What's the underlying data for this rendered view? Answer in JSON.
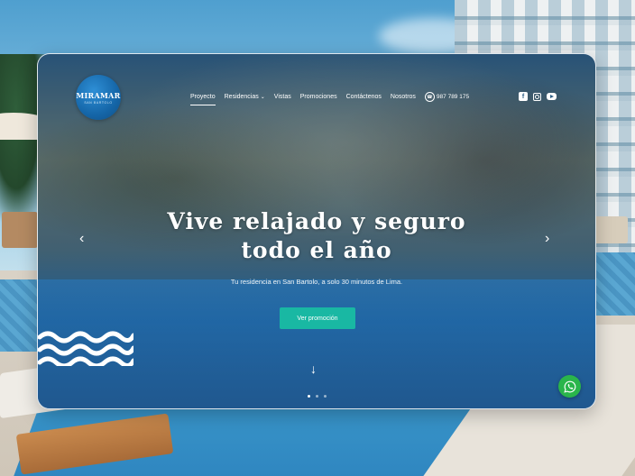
{
  "brand": {
    "name": "MIRAMAR",
    "tagline": "SAN BARTOLO"
  },
  "nav": {
    "items": [
      {
        "label": "Proyecto",
        "active": true
      },
      {
        "label": "Residencias",
        "has_caret": true
      },
      {
        "label": "Vistas"
      },
      {
        "label": "Promociones"
      },
      {
        "label": "Contáctenos"
      },
      {
        "label": "Nosotros"
      }
    ],
    "phone": "987 789 175",
    "socials": [
      "facebook-icon",
      "instagram-icon",
      "youtube-icon"
    ]
  },
  "hero": {
    "title_line1": "Vive relajado y seguro",
    "title_line2": "todo el año",
    "subtitle": "Tu residencia en San Bartolo, a solo 30 minutos de Lima.",
    "cta_label": "Ver promoción",
    "slides": 3,
    "active_slide": 1
  },
  "colors": {
    "accent": "#19b8a3",
    "logo": "#1566a8",
    "whatsapp": "#2ab54b"
  },
  "icons": {
    "prev": "chevron-left-icon",
    "next": "chevron-right-icon",
    "scroll": "arrow-down-icon",
    "whatsapp": "whatsapp-icon",
    "phone": "whatsapp-phone-icon"
  }
}
